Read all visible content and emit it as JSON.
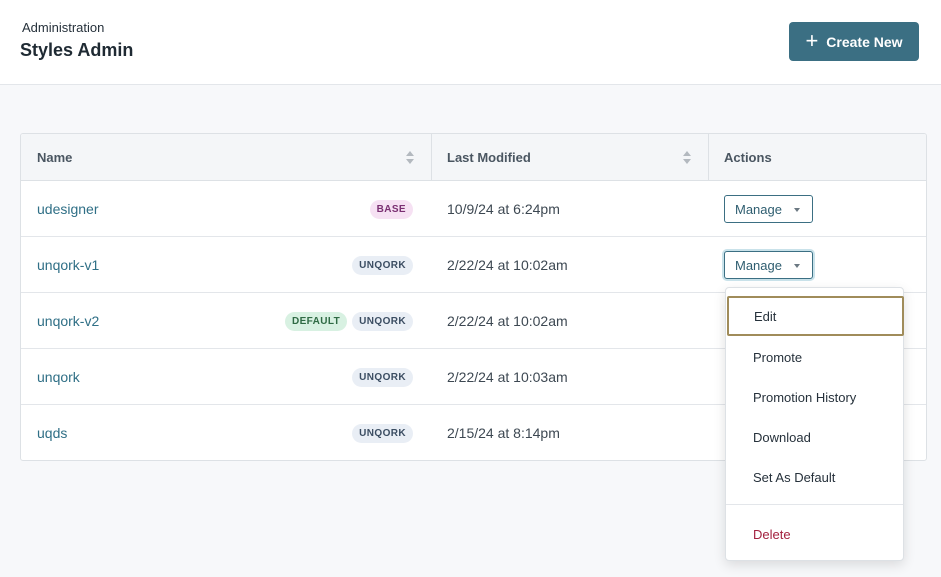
{
  "header": {
    "breadcrumb": "Administration",
    "title": "Styles Admin",
    "create_label": "Create New"
  },
  "table": {
    "columns": [
      "Name",
      "Last Modified",
      "Actions"
    ],
    "rows": [
      {
        "name": "udesigner",
        "badges": [
          "BASE"
        ],
        "modified": "10/9/24 at 6:24pm",
        "action": "Manage"
      },
      {
        "name": "unqork-v1",
        "badges": [
          "UNQORK"
        ],
        "modified": "2/22/24 at 10:02am",
        "action": "Manage"
      },
      {
        "name": "unqork-v2",
        "badges": [
          "DEFAULT",
          "UNQORK"
        ],
        "modified": "2/22/24 at 10:02am"
      },
      {
        "name": "unqork",
        "badges": [
          "UNQORK"
        ],
        "modified": "2/22/24 at 10:03am"
      },
      {
        "name": "uqds",
        "badges": [
          "UNQORK"
        ],
        "modified": "2/15/24 at 8:14pm"
      }
    ]
  },
  "menu": {
    "items": [
      "Edit",
      "Promote",
      "Promotion History",
      "Download",
      "Set As Default"
    ],
    "delete_label": "Delete"
  },
  "colors": {
    "primary": "#3b6f83",
    "link": "#2f6f86",
    "danger": "#a3213f",
    "focus_outline": "#a08c5a"
  }
}
